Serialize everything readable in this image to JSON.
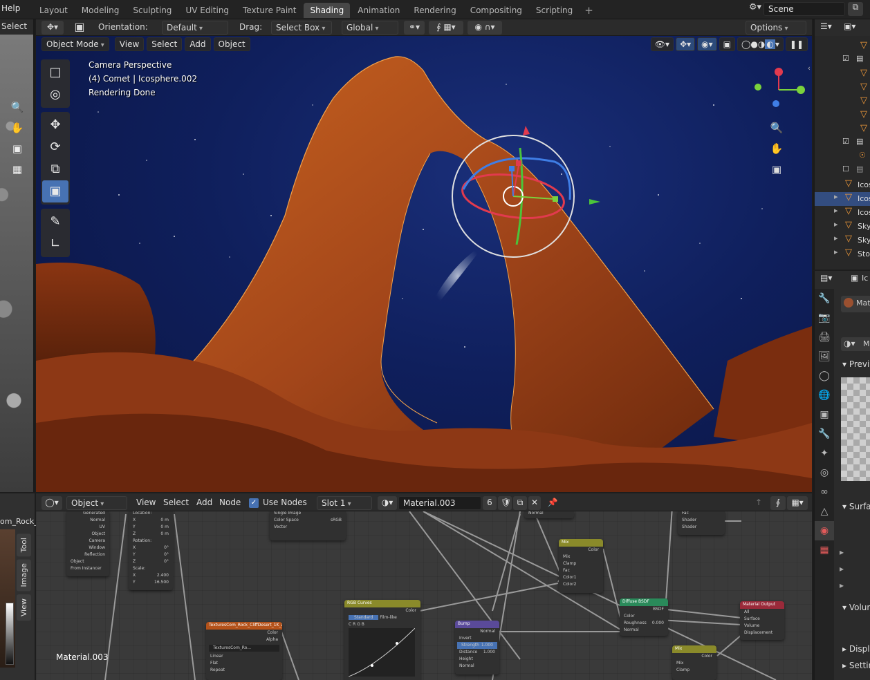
{
  "topbar": {
    "help_menu": "Help",
    "workspace_tabs": [
      "Layout",
      "Modeling",
      "Sculpting",
      "UV Editing",
      "Texture Paint",
      "Shading",
      "Animation",
      "Rendering",
      "Compositing",
      "Scripting"
    ],
    "active_tab": "Shading",
    "scene_name": "Scene"
  },
  "toolbar": {
    "left_select": "Select",
    "orientation_label": "Orientation:",
    "orientation_value": "Default",
    "drag_label": "Drag:",
    "drag_value": "Select Box",
    "transform_value": "Global",
    "options_label": "Options"
  },
  "viewport": {
    "mode": "Object Mode",
    "menus": [
      "View",
      "Select",
      "Add",
      "Object"
    ],
    "info_lines": [
      "Camera Perspective",
      "(4) Comet | Icosphere.002",
      "Rendering Done"
    ]
  },
  "node_editor": {
    "object_type": "Object",
    "menus": [
      "View",
      "Select",
      "Add",
      "Node"
    ],
    "use_nodes_label": "Use Nodes",
    "use_nodes_checked": true,
    "slot": "Slot 1",
    "material_name": "Material.003",
    "user_count": "6",
    "material_label": "Material.003",
    "left_clip_text": "om_Rock_",
    "side_tabs": [
      "Tool",
      "Image",
      "View"
    ],
    "nodes": {
      "texcoord": {
        "rows": [
          "Generated",
          "Normal",
          "UV",
          "Object",
          "Camera",
          "Window",
          "Reflection"
        ],
        "object_label": "Object",
        "from_instancer": "From Instancer"
      },
      "mapping": {
        "location": "Location:",
        "rotation": "Rotation:",
        "scale": "Scale:",
        "loc_vals": [
          "0 m",
          "0 m",
          "0 m"
        ],
        "rot_vals": [
          "0°",
          "0°",
          "0°"
        ],
        "scale_vals": [
          "2.400",
          "16.500",
          "14.500"
        ],
        "axes": [
          "X",
          "Y",
          "Z"
        ]
      },
      "image_top": {
        "rows": [
          "Repeat",
          "Single Image",
          "Color Space",
          "sRGB",
          "Vector"
        ]
      },
      "image_tex": {
        "title": "TexturesCom_Rock_CliffDesert_1K_al...",
        "color": "Color",
        "alpha": "Alpha",
        "file": "TexturesCom_Ro...",
        "interp": "Linear",
        "proj": "Flat",
        "ext": "Repeat"
      },
      "rgb_curves": {
        "title": "RGB Curves",
        "color": "Color",
        "standard": "Standard",
        "filmlike": "Film-like",
        "channels": [
          "C",
          "R",
          "G",
          "B"
        ]
      },
      "bump": {
        "title": "Bump",
        "normal_out": "Normal",
        "invert": "Invert",
        "strength": "Strength",
        "strength_val": "1.000",
        "distance": "Distance",
        "distance_val": "1.000",
        "height": "Height",
        "normal_in": "Normal"
      },
      "mix1": {
        "title": "Mix",
        "color": "Color",
        "mode": "Mix",
        "clamp": "Clamp",
        "fac": "Fac",
        "c1": "Color1",
        "c2": "Color2"
      },
      "diffuse": {
        "title": "Diffuse BSDF",
        "bsdf": "BSDF",
        "color": "Color",
        "roughness": "Roughness",
        "rough_val": "0.000",
        "normal": "Normal"
      },
      "mix_shader": {
        "rows": [
          "Fac",
          "Shader",
          "Shader"
        ]
      },
      "output": {
        "title": "Material Output",
        "target": "All",
        "surface": "Surface",
        "volume": "Volume",
        "displacement": "Displacement"
      },
      "mix2": {
        "title": "Mix",
        "color": "Color",
        "mode": "Mix",
        "clamp": "Clamp"
      },
      "top_partial": {
        "normal": "Normal"
      }
    }
  },
  "outliner": {
    "items": [
      "Icos",
      "Icos",
      "Icos",
      "Sky",
      "Sky",
      "Stor"
    ]
  },
  "properties": {
    "material_slot": "Mat",
    "shading_label": "M",
    "sections": [
      "Previe",
      "Surfac",
      "Volun",
      "Displa",
      "Settin"
    ],
    "header_label": "Ic"
  },
  "colors": {
    "accent": "#4772b3",
    "active_tab_bg": "#474747",
    "selection": "#334d80",
    "rock": "#b5541c",
    "sky": "#0f1f5c"
  }
}
